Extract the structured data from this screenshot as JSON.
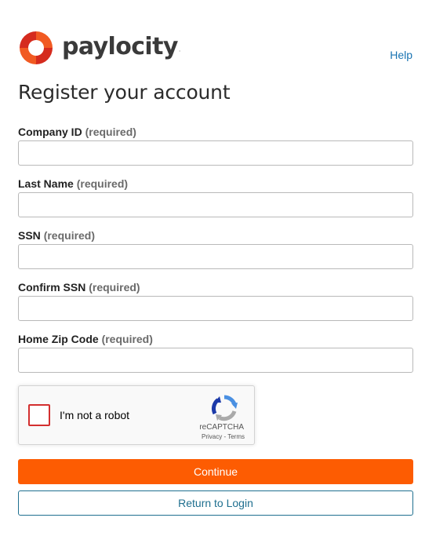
{
  "brand": {
    "name": "paylocity",
    "trademark": "·",
    "logo_icon": "paylocity-logo-icon",
    "colors": {
      "orange": "#f15a22",
      "red": "#d52b1e",
      "text": "#3a3a3a"
    }
  },
  "header": {
    "help_label": "Help"
  },
  "page": {
    "title": "Register your account"
  },
  "form": {
    "fields": [
      {
        "label": "Company ID",
        "required_text": "(required)",
        "value": "",
        "placeholder": ""
      },
      {
        "label": "Last Name",
        "required_text": "(required)",
        "value": "",
        "placeholder": ""
      },
      {
        "label": "SSN",
        "required_text": "(required)",
        "value": "",
        "placeholder": ""
      },
      {
        "label": "Confirm SSN",
        "required_text": "(required)",
        "value": "",
        "placeholder": ""
      },
      {
        "label": "Home Zip Code",
        "required_text": "(required)",
        "value": "",
        "placeholder": ""
      }
    ]
  },
  "recaptcha": {
    "checkbox_label": "I'm not a robot",
    "brand": "reCAPTCHA",
    "privacy": "Privacy",
    "separator": " - ",
    "terms": "Terms",
    "icon": "recaptcha-logo-icon",
    "checked": false,
    "state": "error"
  },
  "actions": {
    "continue_label": "Continue",
    "return_label": "Return to Login",
    "primary_color": "#fd5c02",
    "secondary_color": "#1f6f8f"
  }
}
